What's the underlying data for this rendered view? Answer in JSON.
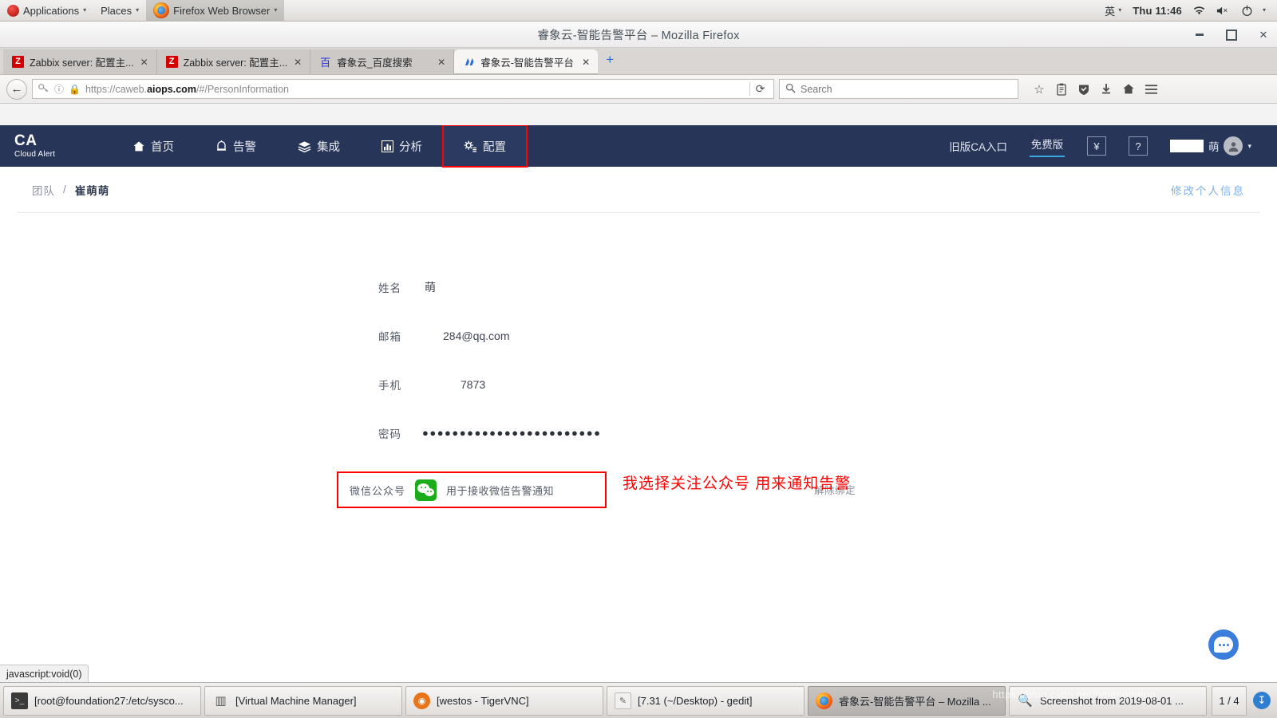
{
  "desktop_panel": {
    "applications_label": "Applications",
    "places_label": "Places",
    "firefox_label": "Firefox Web Browser",
    "input_method": "英",
    "clock": "Thu 11:46",
    "icons": {
      "app_menu": "fedora-icon",
      "wifi": "wifi-icon",
      "volume": "volume-muted-icon",
      "power": "power-icon",
      "caret": "▾"
    }
  },
  "browser": {
    "window_title": "睿象云-智能告警平台 – Mozilla Firefox",
    "window_controls": {
      "minimize": "–",
      "maximize": "□",
      "close": "✕"
    },
    "tabs": [
      {
        "label": "Zabbix server: 配置主...",
        "favicon": "Z",
        "selected": false
      },
      {
        "label": "Zabbix server: 配置主...",
        "favicon": "Z",
        "selected": false
      },
      {
        "label": "睿象云_百度搜索",
        "favicon": "百",
        "selected": false
      },
      {
        "label": "睿象云-智能告警平台",
        "favicon": "CA",
        "selected": true
      }
    ],
    "new_tab_label": "+",
    "url": {
      "scheme": "https://",
      "subdomain": "caweb.",
      "domain": "aiops.com",
      "path": "/#/PersonInformation",
      "full": "https://caweb.aiops.com/#/PersonInformation"
    },
    "search_placeholder": "Search",
    "toolbar_icons": [
      "bookmark-star-icon",
      "reader-icon",
      "shield-icon",
      "download-icon",
      "home-icon",
      "hamburger-menu-icon"
    ],
    "status_tooltip": "javascript:void(0)"
  },
  "app": {
    "logo": {
      "title": "CA",
      "subtitle": "Cloud Alert"
    },
    "nav_items": [
      {
        "label": "首页",
        "icon": "home-icon",
        "highlighted": false
      },
      {
        "label": "告警",
        "icon": "alarm-icon",
        "highlighted": false
      },
      {
        "label": "集成",
        "icon": "layers-icon",
        "highlighted": false
      },
      {
        "label": "分析",
        "icon": "chart-icon",
        "highlighted": false
      },
      {
        "label": "配置",
        "icon": "settings-icon",
        "highlighted": true
      }
    ],
    "nav_right": {
      "legacy_entry": "旧版CA入口",
      "edition": "免费版",
      "billing_icon": "¥",
      "help_icon": "?",
      "user_name": "萌",
      "avatar_icon": "user-avatar-icon",
      "dropdown_caret": "▾"
    }
  },
  "content": {
    "breadcrumb": {
      "parent": "团队",
      "separator": "/",
      "current": "崔萌萌"
    },
    "edit_link": "修改个人信息",
    "fields": [
      {
        "label": "姓名",
        "value": "萌"
      },
      {
        "label": "邮箱",
        "value": "284@qq.com"
      },
      {
        "label": "手机",
        "value": "7873"
      },
      {
        "label": "密码",
        "value": "●●●●●●●●●●●●●●●●●●●●●●●●"
      }
    ],
    "wechat": {
      "label": "微信公众号",
      "icon": "wechat-icon",
      "description": "用于接收微信告警通知",
      "unbind_link": "解除绑定"
    },
    "annotation": "我选择关注公众号 用来通知告警",
    "chat_bubble_icon": "chat-bubble-icon"
  },
  "taskbar": {
    "items": [
      {
        "label": "[root@foundation27:/etc/sysco...",
        "icon": "terminal-icon",
        "active": false
      },
      {
        "label": "[Virtual Machine Manager]",
        "icon": "vmm-icon",
        "active": false
      },
      {
        "label": "[westos - TigerVNC]",
        "icon": "vnc-icon",
        "active": false
      },
      {
        "label": "[7.31 (~/Desktop) - gedit]",
        "icon": "gedit-icon",
        "active": false
      },
      {
        "label": "睿象云-智能告警平台 – Mozilla ...",
        "icon": "firefox-icon",
        "active": true
      },
      {
        "label": "Screenshot from 2019-08-01 ...",
        "icon": "screenshot-icon",
        "active": false
      }
    ],
    "workspace": "1 / 4",
    "tray_icon": "tray-icon",
    "watermark": "https://blog.csdn.net/bmengmeng"
  }
}
